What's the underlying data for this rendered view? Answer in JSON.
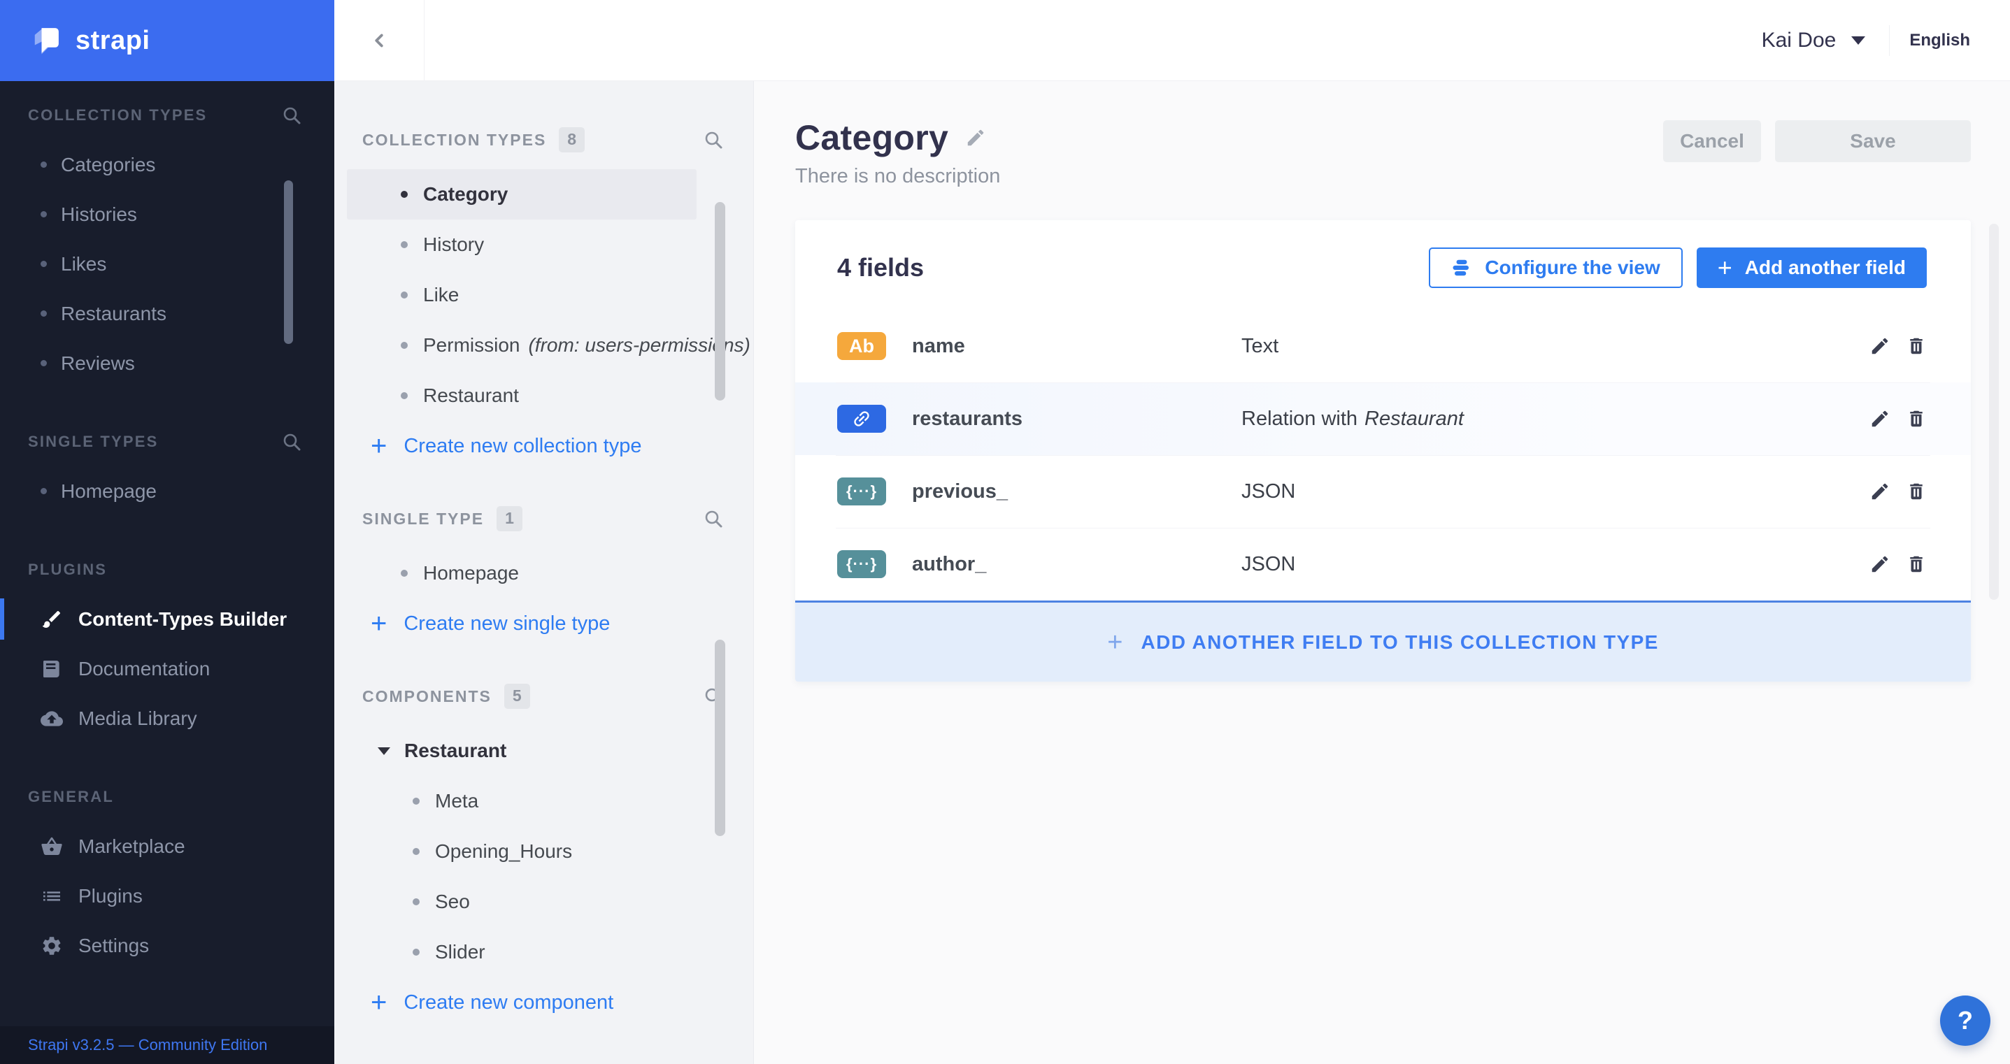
{
  "brand": {
    "name": "strapi"
  },
  "header": {
    "user": "Kai Doe",
    "language": "English"
  },
  "nav": {
    "ct_label": "COLLECTION TYPES",
    "ct_items": [
      "Categories",
      "Histories",
      "Likes",
      "Restaurants",
      "Reviews"
    ],
    "st_label": "SINGLE TYPES",
    "st_items": [
      "Homepage"
    ],
    "plugins_label": "PLUGINS",
    "plugin_items": [
      "Content-Types Builder",
      "Documentation",
      "Media Library"
    ],
    "general_label": "GENERAL",
    "general_items": [
      "Marketplace",
      "Plugins",
      "Settings"
    ],
    "version": "Strapi v3.2.5 — Community Edition"
  },
  "subnav": {
    "ct_label": "COLLECTION TYPES",
    "ct_count": "8",
    "ct_items": [
      "Category",
      "History",
      "Like",
      "Permission",
      "Restaurant"
    ],
    "permission_suffix": "(from: users-permissions)",
    "ct_action": "Create new collection type",
    "st_label": "SINGLE TYPE",
    "st_count": "1",
    "st_items": [
      "Homepage"
    ],
    "st_action": "Create new single type",
    "comp_label": "COMPONENTS",
    "comp_count": "5",
    "comp_group": "Restaurant",
    "comp_items": [
      "Meta",
      "Opening_Hours",
      "Seo",
      "Slider"
    ],
    "comp_action": "Create new component"
  },
  "page": {
    "title": "Category",
    "subtitle": "There is no description",
    "cancel": "Cancel",
    "save": "Save"
  },
  "table": {
    "count_label": "4 fields",
    "configure_label": "Configure the view",
    "add_label": "Add another field",
    "add_plus": "+",
    "rows": [
      {
        "badge": "Ab",
        "name": "name",
        "type": "Text"
      },
      {
        "name": "restaurants",
        "type_prefix": "Relation with",
        "type_target": "Restaurant"
      },
      {
        "badge": "{···}",
        "name": "previous_",
        "type": "JSON"
      },
      {
        "badge": "{···}",
        "name": "author_",
        "type": "JSON"
      }
    ],
    "banner_plus": "+",
    "banner": "ADD ANOTHER FIELD TO THIS COLLECTION TYPE"
  },
  "colors": {
    "accent": "#2e7cf0",
    "badge_text": "#f5a83c",
    "badge_relation": "#2d69e3",
    "badge_json": "#56909a",
    "brand_blue": "#3b6cf0"
  },
  "help": {
    "label": "?"
  }
}
